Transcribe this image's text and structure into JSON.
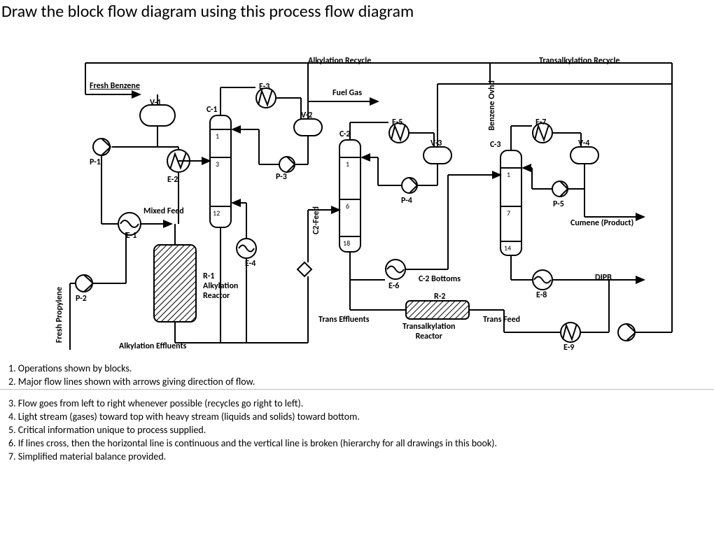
{
  "title": "Draw the block flow diagram using this process flow diagram",
  "pfd": {
    "top_labels": {
      "alkylation_recycle": "Alkylation Recycle",
      "transalkylation_recycle": "Transalkylation Recycle"
    },
    "streams": {
      "fresh_benzene": "Fresh Benzene",
      "fresh_propylene": "Fresh Propylene",
      "mixed_feed": "Mixed Feed",
      "alkylation_effluents": "Alkylation Effluents",
      "fuel_gas": "Fuel Gas",
      "c2_feed": "C2-Feed",
      "c2_bottoms": "C-2 Bottoms",
      "trans_effluents": "Trans Effluents",
      "trans_feed": "Trans Feed",
      "benzene_ovhd": "Benzene Ovhd",
      "cumene_product": "Cumene (Product)",
      "dipb": "DIPB"
    },
    "equipment": {
      "V1": "V-1",
      "V2": "V-2",
      "V3": "V-3",
      "V4": "V-4",
      "P1": "P-1",
      "P2": "P-2",
      "P3": "P-3",
      "P4": "P-4",
      "P5": "P-5",
      "E1": "E-1",
      "E2": "E-2",
      "E3": "E-3",
      "E4": "E-4",
      "E5": "E-5",
      "E6": "E-6",
      "E7": "E-7",
      "E8": "E-8",
      "E9": "E-9",
      "C1": "C-1",
      "C2": "C-2",
      "C3": "C-3",
      "R1": "R-1",
      "R2": "R-2",
      "R1_title": "Alkylation\nReactor",
      "R2_title": "Transalkylation\nReactor"
    },
    "trays": {
      "c1_top": "1",
      "c1_mid": "3",
      "c1_bot": "12",
      "c2_top": "1",
      "c2_mid": "6",
      "c2_bot": "18",
      "c3_top": "1",
      "c3_mid": "7",
      "c3_bot": "14"
    }
  },
  "notes": {
    "n1": "1. Operations shown by blocks.",
    "n2": "2. Major flow lines shown with arrows giving direction of flow.",
    "n3": "3. Flow goes from left to right whenever possible (recycles go right to left).",
    "n4": "4. Light stream (gases) toward top with heavy stream (liquids and solids) toward bottom.",
    "n5": "5. Critical information unique to process supplied.",
    "n6": "6. If lines cross, then the horizontal line is continuous and the vertical line is broken (hierarchy for all drawings in this book).",
    "n7": "7. Simplified material balance provided."
  }
}
